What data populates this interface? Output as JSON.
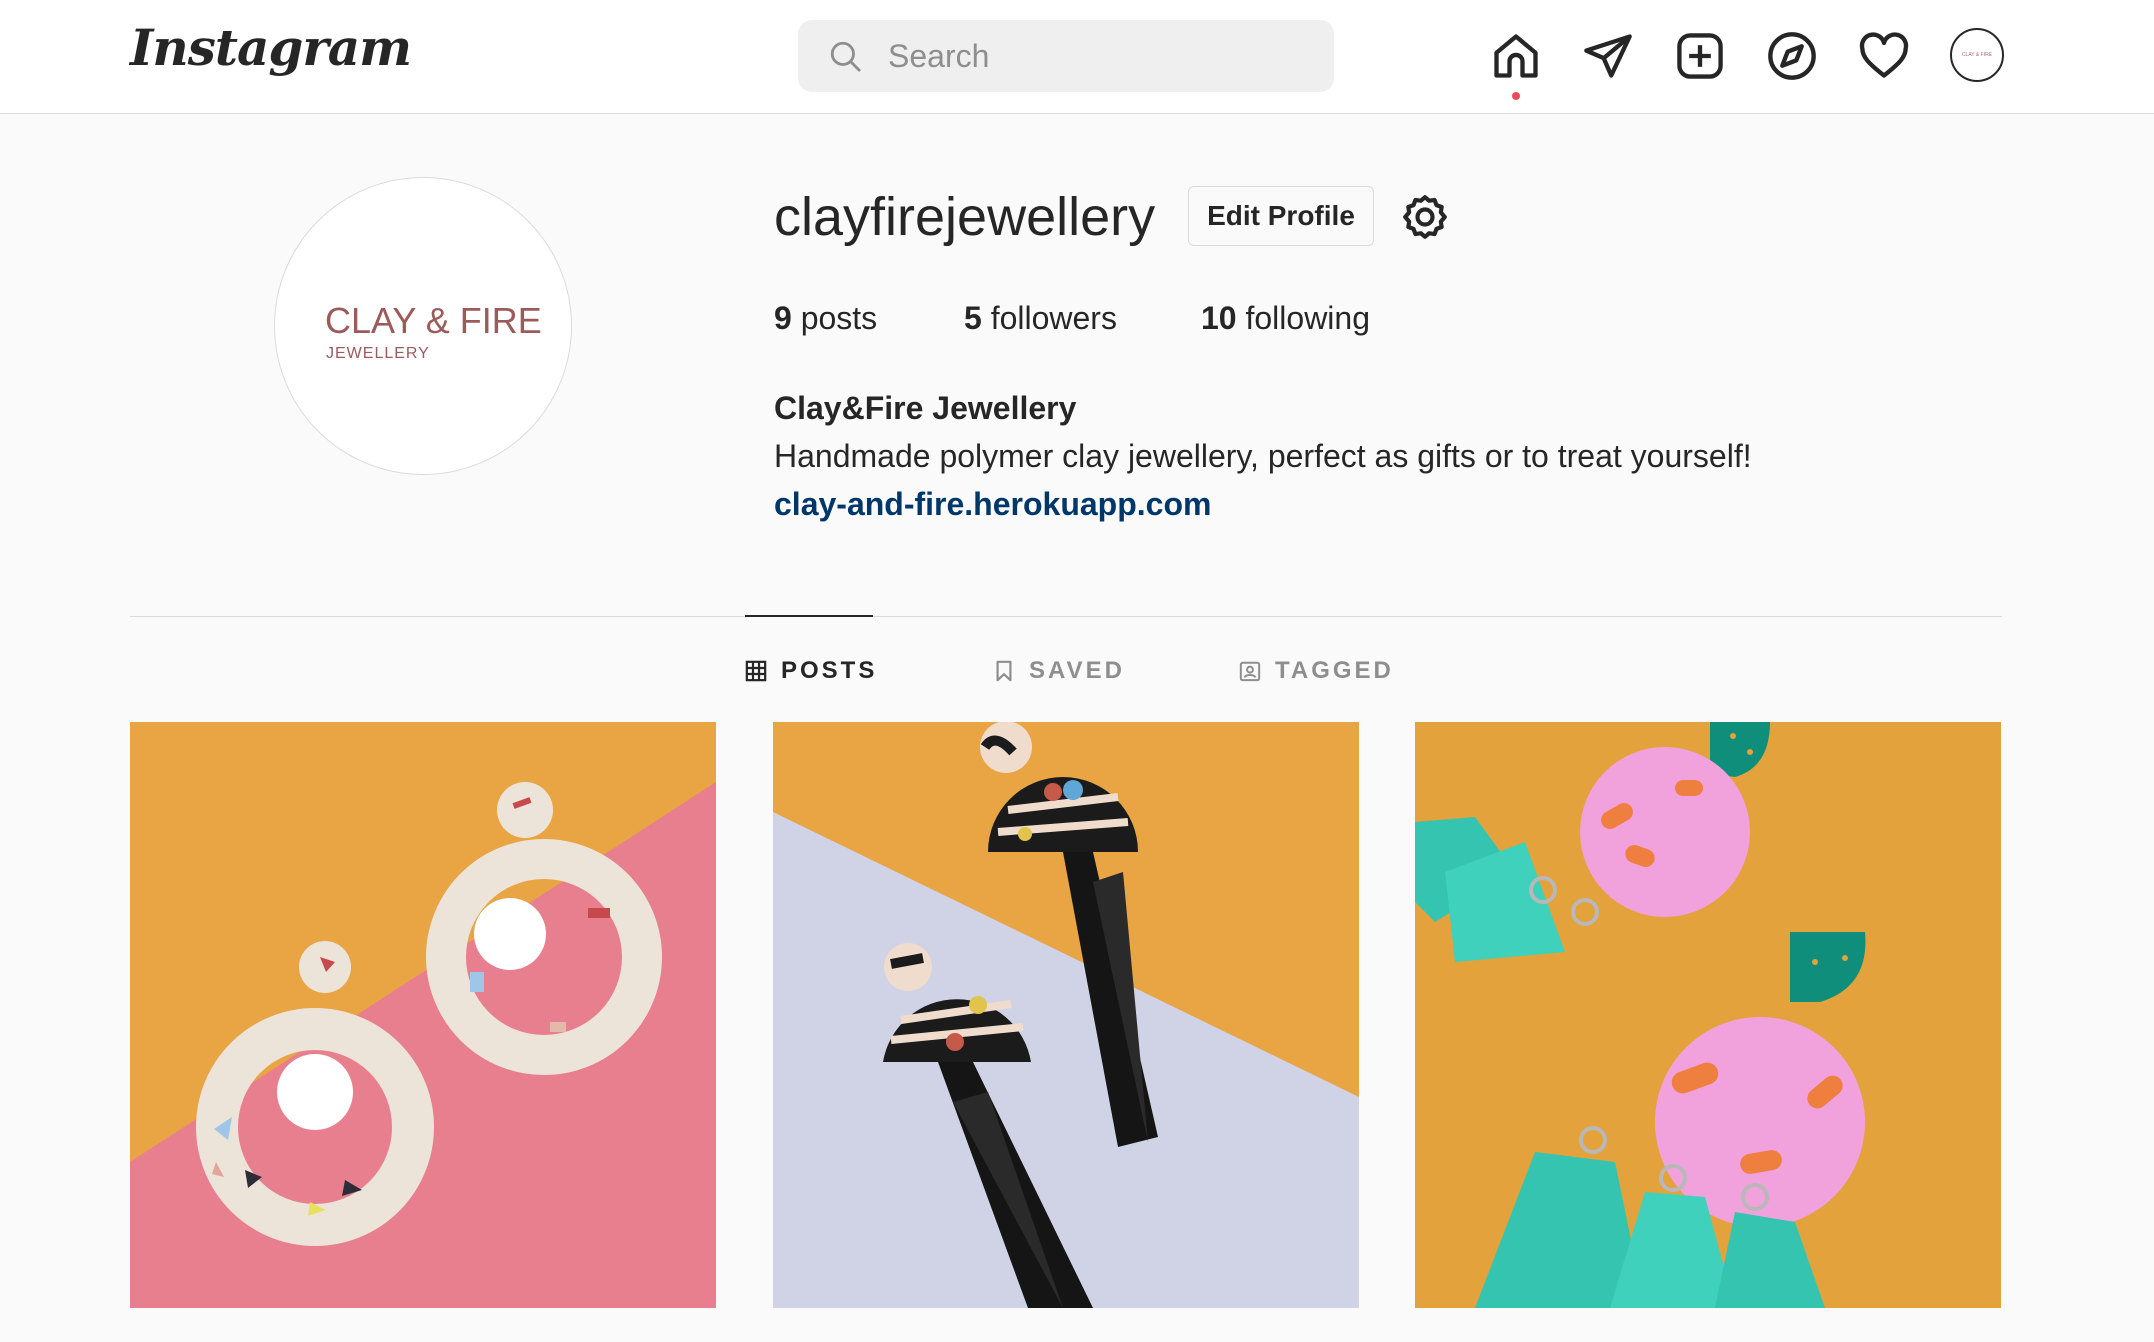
{
  "header": {
    "logo": "Instagram",
    "search_placeholder": "Search",
    "nav_icons": [
      "home-icon",
      "direct-message-icon",
      "new-post-icon",
      "explore-icon",
      "activity-heart-icon",
      "profile-avatar-icon"
    ],
    "notification_dot_color": "#ed4956",
    "profile_avatar_text": "CLAY & FIRE"
  },
  "profile": {
    "avatar_brand": "CLAY & FIRE",
    "avatar_sub": "JEWELLERY",
    "username": "clayfirejewellery",
    "edit_button": "Edit Profile",
    "settings_icon": "gear-icon",
    "stats": {
      "posts_count": "9",
      "posts_label": "posts",
      "followers_count": "5",
      "followers_label": "followers",
      "following_count": "10",
      "following_label": "following"
    },
    "full_name": "Clay&Fire Jewellery",
    "bio": "Handmade polymer clay jewellery, perfect as gifts or to treat yourself!",
    "website": "clay-and-fire.herokuapp.com"
  },
  "tabs": [
    {
      "label": "POSTS",
      "icon": "grid-icon",
      "active": true
    },
    {
      "label": "SAVED",
      "icon": "bookmark-icon",
      "active": false
    },
    {
      "label": "TAGGED",
      "icon": "tagged-icon",
      "active": false
    }
  ],
  "posts": [
    {
      "alt": "terrazzo hoop earrings with white pom poms"
    },
    {
      "alt": "black and white striped tassel earrings"
    },
    {
      "alt": "pink and teal tassel earrings"
    }
  ],
  "colors": {
    "background": "#fafafa",
    "text": "#262626",
    "link": "#00376b",
    "muted": "#8e8e8e",
    "border": "#dbdbdb"
  }
}
